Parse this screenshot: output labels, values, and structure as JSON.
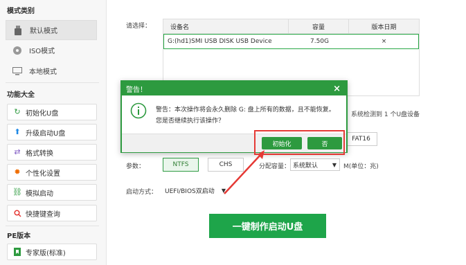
{
  "sidebar": {
    "mode_title": "模式类别",
    "modes": [
      {
        "label": "默认模式",
        "icon": "usb-icon"
      },
      {
        "label": "ISO模式",
        "icon": "disc-icon"
      },
      {
        "label": "本地模式",
        "icon": "monitor-icon"
      }
    ],
    "func_title": "功能大全",
    "functions": [
      {
        "label": "初始化U盘",
        "icon": "refresh-icon"
      },
      {
        "label": "升级启动U盘",
        "icon": "arrow-up-icon"
      },
      {
        "label": "格式转换",
        "icon": "swap-icon"
      },
      {
        "label": "个性化设置",
        "icon": "gear-icon"
      },
      {
        "label": "模拟启动",
        "icon": "link-icon"
      },
      {
        "label": "快捷键查询",
        "icon": "search-icon"
      }
    ],
    "pe_title": "PE版本",
    "pe_items": [
      {
        "label": "专家版(标准)",
        "icon": "bookmark-icon"
      }
    ]
  },
  "main": {
    "select_label": "请选择：",
    "table": {
      "headers": [
        "设备名",
        "容量",
        "版本日期"
      ],
      "rows": [
        {
          "device": "G:(hd1)SMI USB DISK USB Device",
          "capacity": "7.50G",
          "date": "×"
        }
      ]
    },
    "detect_text": "系统检测到 1 个U盘设备",
    "fat16": "FAT16",
    "params_label": "参数：",
    "ntfs": "NTFS",
    "chs": "CHS",
    "alloc_label": "分配容量：",
    "alloc_value": "系统默认",
    "unit_text": "M(单位：兆)",
    "boot_label": "启动方式：",
    "boot_value": "UEFI/BIOS双启动",
    "make_button": "一键制作启动U盘"
  },
  "dialog": {
    "title": "警告！",
    "line1": "警告：本次操作将会永久删除 G: 盘上所有的数据，且不能恢复。",
    "line2": "您是否继续执行该操作？",
    "ok": "初始化",
    "cancel": "否"
  },
  "colors": {
    "accent": "#2d9a3f",
    "annotation": "#e53935"
  }
}
